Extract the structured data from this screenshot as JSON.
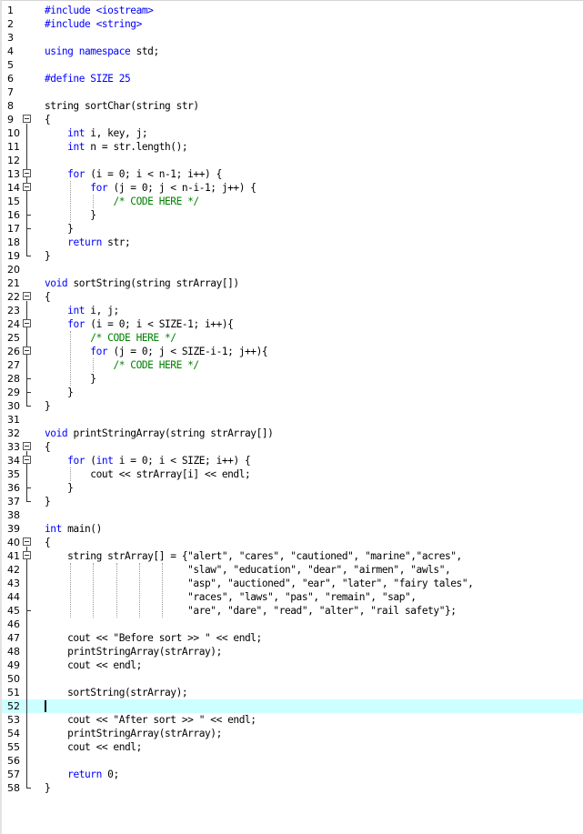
{
  "editor": {
    "current_line": 52,
    "lines": [
      {
        "n": "1",
        "segs": [
          {
            "t": "#include <iostream>",
            "c": "kw"
          }
        ]
      },
      {
        "n": "2",
        "segs": [
          {
            "t": "#include <string>",
            "c": "kw"
          }
        ]
      },
      {
        "n": "3",
        "segs": []
      },
      {
        "n": "4",
        "segs": [
          {
            "t": "using namespace",
            "c": "kw"
          },
          {
            "t": " std;"
          }
        ]
      },
      {
        "n": "5",
        "segs": []
      },
      {
        "n": "6",
        "segs": [
          {
            "t": "#define SIZE 25",
            "c": "kw"
          }
        ]
      },
      {
        "n": "7",
        "segs": []
      },
      {
        "n": "8",
        "segs": [
          {
            "t": "string sortChar(string str)"
          }
        ]
      },
      {
        "n": "9",
        "segs": [
          {
            "t": "{"
          }
        ]
      },
      {
        "n": "10",
        "segs": [
          {
            "t": "    "
          },
          {
            "t": "int",
            "c": "kw"
          },
          {
            "t": " i, key, j;"
          }
        ]
      },
      {
        "n": "11",
        "segs": [
          {
            "t": "    "
          },
          {
            "t": "int",
            "c": "kw"
          },
          {
            "t": " n = str.length();"
          }
        ]
      },
      {
        "n": "12",
        "segs": []
      },
      {
        "n": "13",
        "segs": [
          {
            "t": "    "
          },
          {
            "t": "for",
            "c": "kw"
          },
          {
            "t": " (i = 0; i < n-1; i++) {"
          }
        ]
      },
      {
        "n": "14",
        "segs": [
          {
            "t": "        "
          },
          {
            "t": "for",
            "c": "kw"
          },
          {
            "t": " (j = 0; j < n-i-1; j++) {"
          }
        ]
      },
      {
        "n": "15",
        "segs": [
          {
            "t": "            "
          },
          {
            "t": "/* CODE HERE */",
            "c": "cm"
          }
        ]
      },
      {
        "n": "16",
        "segs": [
          {
            "t": "        }"
          }
        ]
      },
      {
        "n": "17",
        "segs": [
          {
            "t": "    }"
          }
        ]
      },
      {
        "n": "18",
        "segs": [
          {
            "t": "    "
          },
          {
            "t": "return",
            "c": "kw"
          },
          {
            "t": " str;"
          }
        ]
      },
      {
        "n": "19",
        "segs": [
          {
            "t": "}"
          }
        ]
      },
      {
        "n": "20",
        "segs": []
      },
      {
        "n": "21",
        "segs": [
          {
            "t": "void",
            "c": "kw"
          },
          {
            "t": " sortString(string strArray[])"
          }
        ]
      },
      {
        "n": "22",
        "segs": [
          {
            "t": "{"
          }
        ]
      },
      {
        "n": "23",
        "segs": [
          {
            "t": "    "
          },
          {
            "t": "int",
            "c": "kw"
          },
          {
            "t": " i, j;"
          }
        ]
      },
      {
        "n": "24",
        "segs": [
          {
            "t": "    "
          },
          {
            "t": "for",
            "c": "kw"
          },
          {
            "t": " (i = 0; i < SIZE-1; i++){"
          }
        ]
      },
      {
        "n": "25",
        "segs": [
          {
            "t": "        "
          },
          {
            "t": "/* CODE HERE */",
            "c": "cm"
          }
        ]
      },
      {
        "n": "26",
        "segs": [
          {
            "t": "        "
          },
          {
            "t": "for",
            "c": "kw"
          },
          {
            "t": " (j = 0; j < SIZE-i-1; j++){"
          }
        ]
      },
      {
        "n": "27",
        "segs": [
          {
            "t": "            "
          },
          {
            "t": "/* CODE HERE */",
            "c": "cm"
          }
        ]
      },
      {
        "n": "28",
        "segs": [
          {
            "t": "        }"
          }
        ]
      },
      {
        "n": "29",
        "segs": [
          {
            "t": "    }"
          }
        ]
      },
      {
        "n": "30",
        "segs": [
          {
            "t": "}"
          }
        ]
      },
      {
        "n": "31",
        "segs": []
      },
      {
        "n": "32",
        "segs": [
          {
            "t": "void",
            "c": "kw"
          },
          {
            "t": " printStringArray(string strArray[])"
          }
        ]
      },
      {
        "n": "33",
        "segs": [
          {
            "t": "{"
          }
        ]
      },
      {
        "n": "34",
        "segs": [
          {
            "t": "    "
          },
          {
            "t": "for",
            "c": "kw"
          },
          {
            "t": " ("
          },
          {
            "t": "int",
            "c": "kw"
          },
          {
            "t": " i = 0; i < SIZE; i++) {"
          }
        ]
      },
      {
        "n": "35",
        "segs": [
          {
            "t": "        cout << strArray[i] << endl;"
          }
        ]
      },
      {
        "n": "36",
        "segs": [
          {
            "t": "    }"
          }
        ]
      },
      {
        "n": "37",
        "segs": [
          {
            "t": "}"
          }
        ]
      },
      {
        "n": "38",
        "segs": []
      },
      {
        "n": "39",
        "segs": [
          {
            "t": "int",
            "c": "kw"
          },
          {
            "t": " main()"
          }
        ]
      },
      {
        "n": "40",
        "segs": [
          {
            "t": "{"
          }
        ]
      },
      {
        "n": "41",
        "segs": [
          {
            "t": "    string strArray[] = {\"alert\", \"cares\", \"cautioned\", \"marine\",\"acres\","
          }
        ]
      },
      {
        "n": "42",
        "segs": [
          {
            "t": "                         \"slaw\", \"education\", \"dear\", \"airmen\", \"awls\","
          }
        ]
      },
      {
        "n": "43",
        "segs": [
          {
            "t": "                         \"asp\", \"auctioned\", \"ear\", \"later\", \"fairy tales\","
          }
        ]
      },
      {
        "n": "44",
        "segs": [
          {
            "t": "                         \"races\", \"laws\", \"pas\", \"remain\", \"sap\","
          }
        ]
      },
      {
        "n": "45",
        "segs": [
          {
            "t": "                         \"are\", \"dare\", \"read\", \"alter\", \"rail safety\"};"
          }
        ]
      },
      {
        "n": "46",
        "segs": []
      },
      {
        "n": "47",
        "segs": [
          {
            "t": "    cout << \"Before sort >> \" << endl;"
          }
        ]
      },
      {
        "n": "48",
        "segs": [
          {
            "t": "    printStringArray(strArray);"
          }
        ]
      },
      {
        "n": "49",
        "segs": [
          {
            "t": "    cout << endl;"
          }
        ]
      },
      {
        "n": "50",
        "segs": []
      },
      {
        "n": "51",
        "segs": [
          {
            "t": "    sortString(strArray);"
          }
        ]
      },
      {
        "n": "52",
        "segs": []
      },
      {
        "n": "53",
        "segs": [
          {
            "t": "    cout << \"After sort >> \" << endl;"
          }
        ]
      },
      {
        "n": "54",
        "segs": [
          {
            "t": "    printStringArray(strArray);"
          }
        ]
      },
      {
        "n": "55",
        "segs": [
          {
            "t": "    cout << endl;"
          }
        ]
      },
      {
        "n": "56",
        "segs": []
      },
      {
        "n": "57",
        "segs": [
          {
            "t": "    "
          },
          {
            "t": "return",
            "c": "kw"
          },
          {
            "t": " 0;"
          }
        ]
      },
      {
        "n": "58",
        "segs": [
          {
            "t": "}"
          }
        ]
      }
    ]
  }
}
